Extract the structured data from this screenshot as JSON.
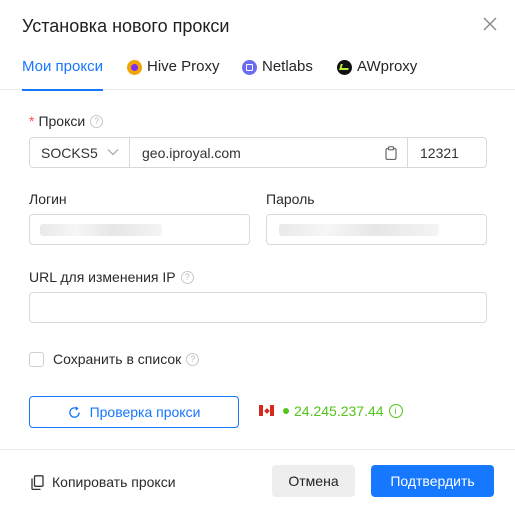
{
  "dialog": {
    "title": "Установка нового прокси"
  },
  "tabs": [
    {
      "label": "Мои прокси",
      "icon": "",
      "active": true
    },
    {
      "label": "Hive Proxy",
      "icon": "hive-proxy-logo-icon",
      "color": "#f0a500"
    },
    {
      "label": "Netlabs",
      "icon": "netlabs-logo-icon",
      "color": "#6c6cf0"
    },
    {
      "label": "AWproxy",
      "icon": "awproxy-logo-icon",
      "color": "#111111"
    }
  ],
  "proxy": {
    "required_mark": "*",
    "label": "Прокси",
    "protocol": "SOCKS5",
    "host": "geo.iproyal.com",
    "port": "12321"
  },
  "login": {
    "label": "Логин"
  },
  "password": {
    "label": "Пароль"
  },
  "change_ip_url": {
    "label": "URL для изменения IP",
    "value": ""
  },
  "save_to_list": {
    "label": "Сохранить в список",
    "checked": false
  },
  "check_button": {
    "label": "Проверка прокси"
  },
  "check_result": {
    "country_flag": "canada-flag-icon",
    "ip": "24.245.237.44",
    "status_color": "#52c41a"
  },
  "footer": {
    "copy_label": "Копировать прокси",
    "cancel_label": "Отмена",
    "confirm_label": "Подтвердить"
  },
  "colors": {
    "accent": "#1677ff",
    "required": "#ff4d4f",
    "success": "#52c41a"
  }
}
